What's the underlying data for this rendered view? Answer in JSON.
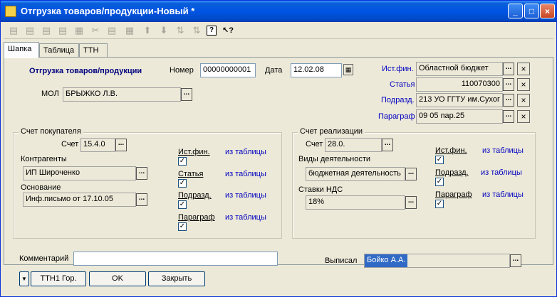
{
  "window": {
    "title": "Отгрузка товаров/продукции-Новый *",
    "minimize_glyph": "_",
    "maximize_glyph": "□",
    "close_glyph": "×"
  },
  "toolbar": {
    "tools": [
      {
        "name": "new-icon",
        "glyph": "▤"
      },
      {
        "name": "copy-icon",
        "glyph": "▤"
      },
      {
        "name": "edit-icon",
        "glyph": "▤"
      },
      {
        "name": "delete-icon",
        "glyph": "▤"
      },
      {
        "name": "mark-delete-icon",
        "glyph": "▦"
      },
      {
        "name": "cut-icon",
        "glyph": "✂"
      },
      {
        "name": "properties-icon",
        "glyph": "▤"
      },
      {
        "name": "hierarchy-icon",
        "glyph": "▦"
      },
      {
        "name": "move-up-icon",
        "glyph": "⬆"
      },
      {
        "name": "move-down-icon",
        "glyph": "⬇"
      },
      {
        "name": "sort-asc-icon",
        "glyph": "⇅"
      },
      {
        "name": "sort-desc-icon",
        "glyph": "⇅"
      },
      {
        "name": "help-icon",
        "glyph": "?"
      },
      {
        "name": "context-help-icon",
        "glyph": "↖?"
      }
    ]
  },
  "tabs": [
    "Шапка",
    "Таблица",
    "ТТН"
  ],
  "header": {
    "doc_title": "Отгрузка товаров/продукции",
    "number_label": "Номер",
    "number_value": "00000000001",
    "date_label": "Дата",
    "date_value": "12.02.08",
    "mol_label": "МОЛ",
    "mol_value": "БРЫЖКО Л.В.",
    "dots": "...",
    "clear": "×"
  },
  "right_refs": [
    {
      "label": "Ист.фин.",
      "value": "Областной бюджет"
    },
    {
      "label": "Статья",
      "value": "110070300"
    },
    {
      "label": "Подразд.",
      "value": "213 УО ГГТУ им.Сухог"
    },
    {
      "label": "Параграф",
      "value": "09 05 пар.25"
    }
  ],
  "buyer_account": {
    "title": "Счет покупателя",
    "account_label": "Счет",
    "account_value": "15.4.0",
    "contractors_label": "Контрагенты",
    "contractors_value": "ИП Широченко",
    "basis_label": "Основание",
    "basis_value": "Инф.письмо от 17.10.05",
    "flags": [
      {
        "label": "Ист.фин.",
        "source": "из таблицы",
        "checked": true
      },
      {
        "label": "Статья",
        "source": "из таблицы",
        "checked": true
      },
      {
        "label": "Подразд.",
        "source": "из таблицы",
        "checked": true
      },
      {
        "label": "Параграф",
        "source": "из таблицы",
        "checked": true
      }
    ]
  },
  "sales_account": {
    "title": "Счет реализации",
    "account_label": "Счет",
    "account_value": "28.0.",
    "activity_label": "Виды деятельности",
    "activity_value": "бюджетная деятельность",
    "vat_label": "Ставки НДС",
    "vat_value": "18%",
    "flags": [
      {
        "label": "Ист.фин.",
        "source": "из таблицы",
        "checked": true
      },
      {
        "label": "Подразд.",
        "source": "из таблицы",
        "checked": true
      },
      {
        "label": "Параграф",
        "source": "из таблицы",
        "checked": true
      }
    ]
  },
  "footer": {
    "comment_label": "Комментарий",
    "comment_value": "",
    "issued_label": "Выписал",
    "issued_value": "Бойко А.А.",
    "menu_arrow": "▼",
    "btn_ttn": "ТТН1 Гор.",
    "btn_ok": "OK",
    "btn_close": "Закрыть"
  },
  "colors": {
    "title_bar": "#0054e3",
    "link_blue": "#0000c0",
    "heading": "#00007f",
    "window_bg": "#ece9d8"
  }
}
